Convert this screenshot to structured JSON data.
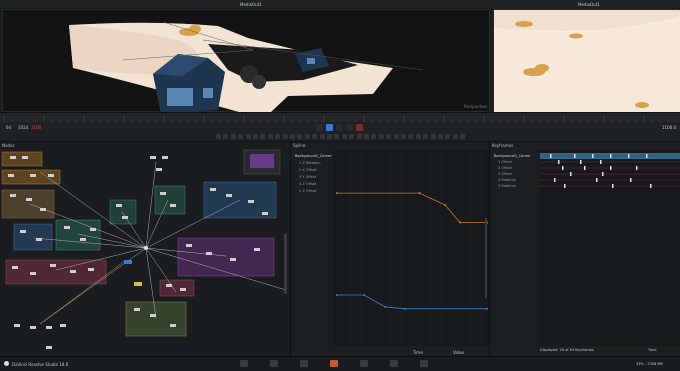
{
  "viewers": {
    "left_title": "MediaOut1",
    "right_title": "MediaOut1",
    "left_corner_text": "Perspective"
  },
  "transport": {
    "left_field_a": "64",
    "left_field_b": "1024",
    "left_field_c": "1100",
    "right_field": "1100.0"
  },
  "panels": {
    "nodes_title": "Nodes",
    "spline_title": "Spline",
    "keyframes_title": "Keyframes"
  },
  "spline": {
    "tree_items": [
      "Background1_Corner",
      "1 Z Rotation",
      "2 X Offset",
      "3 Y Offset",
      "4 Z Offset",
      "5 Z Offset"
    ],
    "bottom_left": "Time",
    "bottom_right": "Value",
    "orange_curve": [
      [
        0,
        0.78
      ],
      [
        0.55,
        0.78
      ],
      [
        0.72,
        0.72
      ],
      [
        0.82,
        0.63
      ],
      [
        1,
        0.63
      ]
    ],
    "blue_curve": [
      [
        0,
        0.26
      ],
      [
        0.18,
        0.26
      ],
      [
        0.32,
        0.2
      ],
      [
        0.45,
        0.19
      ],
      [
        1,
        0.19
      ]
    ]
  },
  "keyframes": {
    "tree_items": [
      "Background1_Corner",
      "1 Offset",
      "2 Offset",
      "3 Offset",
      "4 Rotation",
      "5 Rotation"
    ],
    "footer_left": "Displayed: 20 of 54 Keyframes",
    "footer_right": "Time",
    "footer_right2": "1.0 / 1500.0/30"
  },
  "statusbar": {
    "app_name": "DaVinci Resolve Studio 18.6",
    "right_text": "33% - 2308 MB"
  },
  "colors": {
    "accent_blue": "#3a7bd5",
    "orange_curve": "#c97a2b",
    "blue_curve": "#3a7bd5",
    "sand": "#f2e3d3",
    "house_blue": "#1e3550",
    "group_orange": "#6a4a20",
    "group_blue": "#23405a",
    "group_purple": "#4a2a5a",
    "group_pink": "#5a2a3a",
    "group_teal": "#234a40"
  },
  "page_tabs": [
    "Media",
    "Cut",
    "Edit",
    "Fusion",
    "Color",
    "Fairlight",
    "Deliver"
  ]
}
